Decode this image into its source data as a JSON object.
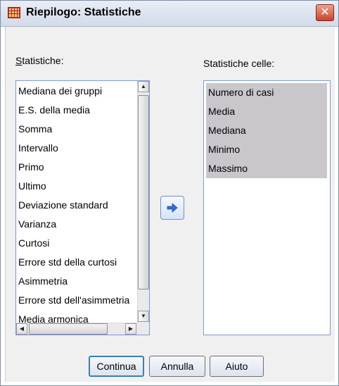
{
  "window": {
    "title": "Riepilogo: Statistiche",
    "close_glyph": "✕"
  },
  "left_panel": {
    "label": "Statistiche:",
    "label_mnemonic": "S",
    "label_rest": "tatistiche:",
    "items": [
      "Mediana dei gruppi",
      "E.S. della media",
      "Somma",
      "Intervallo",
      "Primo",
      "Ultimo",
      "Deviazione standard",
      "Varianza",
      "Curtosi",
      "Errore std della curtosi",
      "Asimmetria",
      "Errore std dell'asimmetria",
      "Media armonica"
    ]
  },
  "move_button": {
    "icon": "arrow-right-icon",
    "color": "#2f6fd6"
  },
  "right_panel": {
    "label": "Statistiche celle:",
    "items": [
      "Numero di casi",
      "Media",
      "Mediana",
      "Minimo",
      "Massimo"
    ],
    "selection_color": "#c9c6cc"
  },
  "buttons": {
    "continue": "Continua",
    "cancel": "Annulla",
    "help": "Aiuto"
  }
}
